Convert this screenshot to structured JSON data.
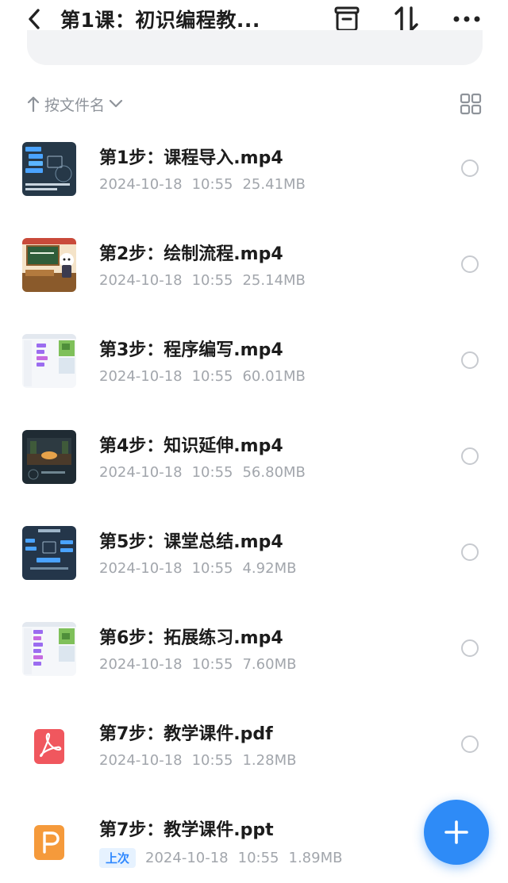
{
  "header": {
    "title": "第1课：初识编程教...",
    "back_icon": "chevron-left-icon",
    "icons": [
      "archive-icon",
      "sort-arrows-icon",
      "more-icon"
    ]
  },
  "sort": {
    "label": "按文件名",
    "arrow_icon": "arrow-up-icon",
    "dropdown_icon": "chevron-down-icon",
    "view_toggle_icon": "grid-view-icon"
  },
  "files": [
    {
      "name": "第1步：课程导入.mp4",
      "date": "2024-10-18",
      "time": "10:55",
      "size": "25.41MB",
      "thumb": "video-thumb-dark-blocks"
    },
    {
      "name": "第2步：绘制流程.mp4",
      "date": "2024-10-18",
      "time": "10:55",
      "size": "25.14MB",
      "thumb": "video-thumb-classroom"
    },
    {
      "name": "第3步：程序编写.mp4",
      "date": "2024-10-18",
      "time": "10:55",
      "size": "60.01MB",
      "thumb": "video-thumb-scratch-editor"
    },
    {
      "name": "第4步：知识延伸.mp4",
      "date": "2024-10-18",
      "time": "10:55",
      "size": "56.80MB",
      "thumb": "video-thumb-dark-scene"
    },
    {
      "name": "第5步：课堂总结.mp4",
      "date": "2024-10-18",
      "time": "10:55",
      "size": "4.92MB",
      "thumb": "video-thumb-dark-blocks"
    },
    {
      "name": "第6步：拓展练习.mp4",
      "date": "2024-10-18",
      "time": "10:55",
      "size": "7.60MB",
      "thumb": "video-thumb-scratch-editor"
    },
    {
      "name": "第7步：教学课件.pdf",
      "date": "2024-10-18",
      "time": "10:55",
      "size": "1.28MB",
      "thumb": "pdf-file-icon"
    },
    {
      "name": "第7步：教学课件.ppt",
      "date": "2024-10-18",
      "time": "10:55",
      "size": "1.89MB",
      "thumb": "ppt-file-icon",
      "badge": "上次"
    }
  ],
  "fab": {
    "icon": "plus-icon"
  },
  "colors": {
    "accent": "#2e8bf7",
    "pdf": "#f0575e",
    "ppt": "#f59a3b",
    "meta_text": "#a2a6ac"
  }
}
